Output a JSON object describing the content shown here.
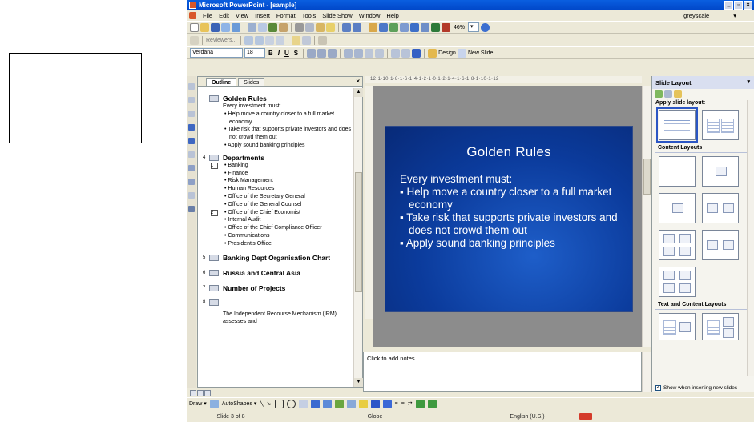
{
  "window": {
    "title": "Microsoft PowerPoint - [sample]"
  },
  "menu": {
    "items": [
      "File",
      "Edit",
      "View",
      "Insert",
      "Format",
      "Tools",
      "Slide Show",
      "Window",
      "Help"
    ],
    "greyscale_label": "greyscale"
  },
  "toolbar": {
    "zoom": "46%",
    "reviewers": "Reviewers...",
    "font_name": "Verdana",
    "font_size": "18",
    "bold": "B",
    "italic": "I",
    "underline": "U",
    "shadow": "S",
    "design": "Design",
    "new_slide": "New Slide"
  },
  "outline_pane": {
    "tabs": [
      "Outline",
      "Slides"
    ],
    "close": "×",
    "slide3": {
      "title": "Golden Rules",
      "lines": [
        {
          "text": "Every investment must:",
          "bullet": false
        },
        {
          "text": "• Help move a country closer to a full market economy",
          "bullet": true
        },
        {
          "text": "• Take risk that supports private investors and does not crowd them out",
          "bullet": true
        },
        {
          "text": "• Apply sound banking principles",
          "bullet": true
        }
      ]
    },
    "slide4": {
      "num": "4",
      "title": "Departments",
      "tag1": "1",
      "tag2": "2",
      "items": [
        "• Banking",
        "• Finance",
        "• Risk Management",
        "• Human Resources",
        "• Office of the Secretary General",
        "• Office of the General Counsel",
        "• Office of the Chief Economist",
        "• Internal Audit",
        "• Office of the Chief Compliance Officer",
        "• Communications",
        "• President's Office"
      ]
    },
    "slide5": {
      "num": "5",
      "title": "Banking Dept Organisation Chart"
    },
    "slide6": {
      "num": "6",
      "title": "Russia and Central Asia"
    },
    "slide7": {
      "num": "7",
      "title": "Number of Projects"
    },
    "slide8": {
      "num": "8",
      "text": "The Independent Recourse Mechanism (IRM) assesses and"
    }
  },
  "ruler": {
    "text": "12·1·10·1·8·1·6·1·4·1·2·1·0·1·2·1·4·1·6·1·8·1·10·1·12"
  },
  "slide": {
    "title": "Golden Rules",
    "body": [
      {
        "text": "Every investment must:",
        "bullet": false
      },
      {
        "text": "▪ Help move a country closer to a full market economy",
        "bullet": true
      },
      {
        "text": "▪ Take risk that supports private investors and does not crowd them out",
        "bullet": true
      },
      {
        "text": "▪ Apply sound banking principles",
        "bullet": true
      }
    ]
  },
  "notes": {
    "placeholder": "Click to add notes"
  },
  "task_pane": {
    "title": "Slide Layout",
    "apply_label": "Apply slide layout:",
    "content_layouts": "Content Layouts",
    "text_content_layouts": "Text and Content Layouts",
    "show_checkbox": "Show when inserting new slides",
    "checked_mark": "✓"
  },
  "drawbar": {
    "draw": "Draw ▾",
    "autoshapes": "AutoShapes ▾"
  },
  "status": {
    "slide": "Slide 3 of 8",
    "design": "Globe",
    "language": "English (U.S.)"
  }
}
